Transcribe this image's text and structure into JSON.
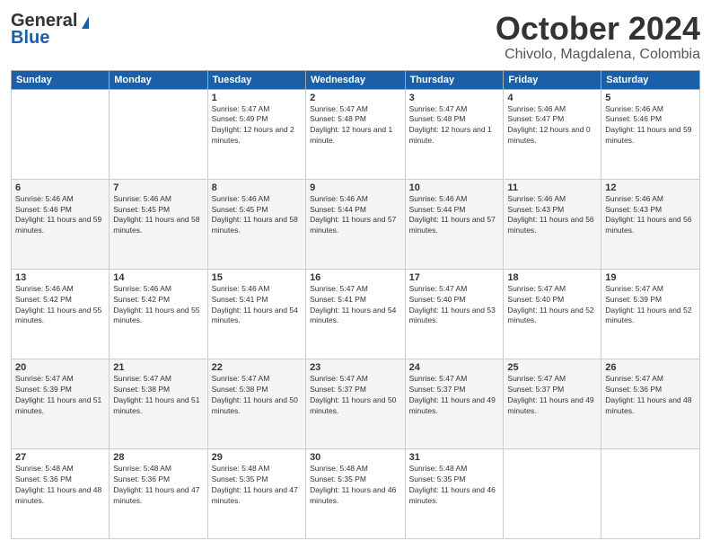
{
  "logo": {
    "general": "General",
    "blue": "Blue"
  },
  "header": {
    "month": "October 2024",
    "location": "Chivolo, Magdalena, Colombia"
  },
  "weekdays": [
    "Sunday",
    "Monday",
    "Tuesday",
    "Wednesday",
    "Thursday",
    "Friday",
    "Saturday"
  ],
  "weeks": [
    [
      {
        "day": "",
        "sunrise": "",
        "sunset": "",
        "daylight": ""
      },
      {
        "day": "",
        "sunrise": "",
        "sunset": "",
        "daylight": ""
      },
      {
        "day": "1",
        "sunrise": "Sunrise: 5:47 AM",
        "sunset": "Sunset: 5:49 PM",
        "daylight": "Daylight: 12 hours and 2 minutes."
      },
      {
        "day": "2",
        "sunrise": "Sunrise: 5:47 AM",
        "sunset": "Sunset: 5:48 PM",
        "daylight": "Daylight: 12 hours and 1 minute."
      },
      {
        "day": "3",
        "sunrise": "Sunrise: 5:47 AM",
        "sunset": "Sunset: 5:48 PM",
        "daylight": "Daylight: 12 hours and 1 minute."
      },
      {
        "day": "4",
        "sunrise": "Sunrise: 5:46 AM",
        "sunset": "Sunset: 5:47 PM",
        "daylight": "Daylight: 12 hours and 0 minutes."
      },
      {
        "day": "5",
        "sunrise": "Sunrise: 5:46 AM",
        "sunset": "Sunset: 5:46 PM",
        "daylight": "Daylight: 11 hours and 59 minutes."
      }
    ],
    [
      {
        "day": "6",
        "sunrise": "Sunrise: 5:46 AM",
        "sunset": "Sunset: 5:46 PM",
        "daylight": "Daylight: 11 hours and 59 minutes."
      },
      {
        "day": "7",
        "sunrise": "Sunrise: 5:46 AM",
        "sunset": "Sunset: 5:45 PM",
        "daylight": "Daylight: 11 hours and 58 minutes."
      },
      {
        "day": "8",
        "sunrise": "Sunrise: 5:46 AM",
        "sunset": "Sunset: 5:45 PM",
        "daylight": "Daylight: 11 hours and 58 minutes."
      },
      {
        "day": "9",
        "sunrise": "Sunrise: 5:46 AM",
        "sunset": "Sunset: 5:44 PM",
        "daylight": "Daylight: 11 hours and 57 minutes."
      },
      {
        "day": "10",
        "sunrise": "Sunrise: 5:46 AM",
        "sunset": "Sunset: 5:44 PM",
        "daylight": "Daylight: 11 hours and 57 minutes."
      },
      {
        "day": "11",
        "sunrise": "Sunrise: 5:46 AM",
        "sunset": "Sunset: 5:43 PM",
        "daylight": "Daylight: 11 hours and 56 minutes."
      },
      {
        "day": "12",
        "sunrise": "Sunrise: 5:46 AM",
        "sunset": "Sunset: 5:43 PM",
        "daylight": "Daylight: 11 hours and 56 minutes."
      }
    ],
    [
      {
        "day": "13",
        "sunrise": "Sunrise: 5:46 AM",
        "sunset": "Sunset: 5:42 PM",
        "daylight": "Daylight: 11 hours and 55 minutes."
      },
      {
        "day": "14",
        "sunrise": "Sunrise: 5:46 AM",
        "sunset": "Sunset: 5:42 PM",
        "daylight": "Daylight: 11 hours and 55 minutes."
      },
      {
        "day": "15",
        "sunrise": "Sunrise: 5:46 AM",
        "sunset": "Sunset: 5:41 PM",
        "daylight": "Daylight: 11 hours and 54 minutes."
      },
      {
        "day": "16",
        "sunrise": "Sunrise: 5:47 AM",
        "sunset": "Sunset: 5:41 PM",
        "daylight": "Daylight: 11 hours and 54 minutes."
      },
      {
        "day": "17",
        "sunrise": "Sunrise: 5:47 AM",
        "sunset": "Sunset: 5:40 PM",
        "daylight": "Daylight: 11 hours and 53 minutes."
      },
      {
        "day": "18",
        "sunrise": "Sunrise: 5:47 AM",
        "sunset": "Sunset: 5:40 PM",
        "daylight": "Daylight: 11 hours and 52 minutes."
      },
      {
        "day": "19",
        "sunrise": "Sunrise: 5:47 AM",
        "sunset": "Sunset: 5:39 PM",
        "daylight": "Daylight: 11 hours and 52 minutes."
      }
    ],
    [
      {
        "day": "20",
        "sunrise": "Sunrise: 5:47 AM",
        "sunset": "Sunset: 5:39 PM",
        "daylight": "Daylight: 11 hours and 51 minutes."
      },
      {
        "day": "21",
        "sunrise": "Sunrise: 5:47 AM",
        "sunset": "Sunset: 5:38 PM",
        "daylight": "Daylight: 11 hours and 51 minutes."
      },
      {
        "day": "22",
        "sunrise": "Sunrise: 5:47 AM",
        "sunset": "Sunset: 5:38 PM",
        "daylight": "Daylight: 11 hours and 50 minutes."
      },
      {
        "day": "23",
        "sunrise": "Sunrise: 5:47 AM",
        "sunset": "Sunset: 5:37 PM",
        "daylight": "Daylight: 11 hours and 50 minutes."
      },
      {
        "day": "24",
        "sunrise": "Sunrise: 5:47 AM",
        "sunset": "Sunset: 5:37 PM",
        "daylight": "Daylight: 11 hours and 49 minutes."
      },
      {
        "day": "25",
        "sunrise": "Sunrise: 5:47 AM",
        "sunset": "Sunset: 5:37 PM",
        "daylight": "Daylight: 11 hours and 49 minutes."
      },
      {
        "day": "26",
        "sunrise": "Sunrise: 5:47 AM",
        "sunset": "Sunset: 5:36 PM",
        "daylight": "Daylight: 11 hours and 48 minutes."
      }
    ],
    [
      {
        "day": "27",
        "sunrise": "Sunrise: 5:48 AM",
        "sunset": "Sunset: 5:36 PM",
        "daylight": "Daylight: 11 hours and 48 minutes."
      },
      {
        "day": "28",
        "sunrise": "Sunrise: 5:48 AM",
        "sunset": "Sunset: 5:36 PM",
        "daylight": "Daylight: 11 hours and 47 minutes."
      },
      {
        "day": "29",
        "sunrise": "Sunrise: 5:48 AM",
        "sunset": "Sunset: 5:35 PM",
        "daylight": "Daylight: 11 hours and 47 minutes."
      },
      {
        "day": "30",
        "sunrise": "Sunrise: 5:48 AM",
        "sunset": "Sunset: 5:35 PM",
        "daylight": "Daylight: 11 hours and 46 minutes."
      },
      {
        "day": "31",
        "sunrise": "Sunrise: 5:48 AM",
        "sunset": "Sunset: 5:35 PM",
        "daylight": "Daylight: 11 hours and 46 minutes."
      },
      {
        "day": "",
        "sunrise": "",
        "sunset": "",
        "daylight": ""
      },
      {
        "day": "",
        "sunrise": "",
        "sunset": "",
        "daylight": ""
      }
    ]
  ]
}
